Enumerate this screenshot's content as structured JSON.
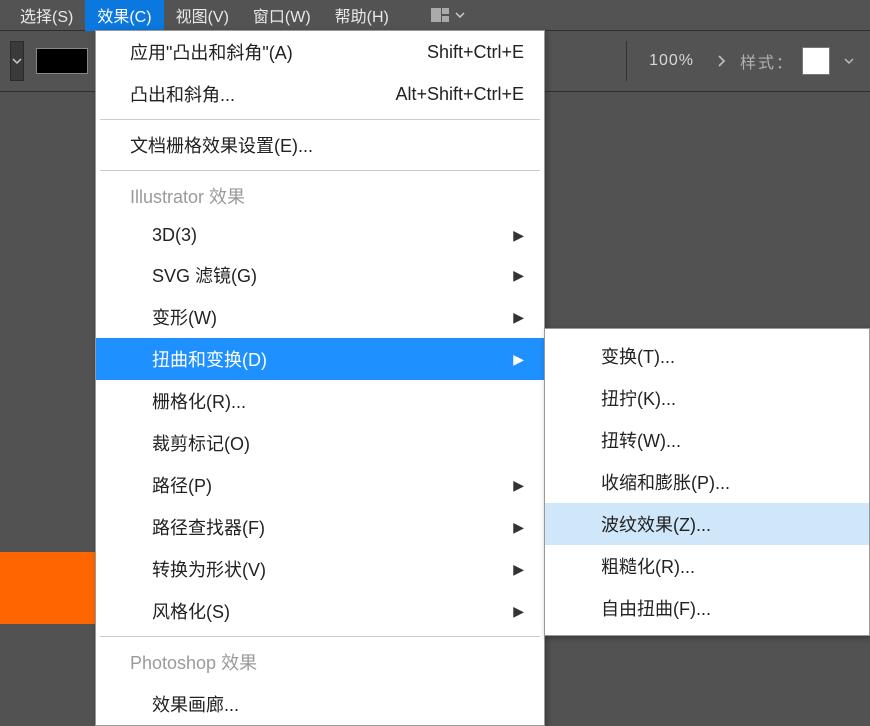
{
  "menubar": {
    "items": [
      {
        "label": "选择(S)"
      },
      {
        "label": "效果(C)"
      },
      {
        "label": "视图(V)"
      },
      {
        "label": "窗口(W)"
      },
      {
        "label": "帮助(H)"
      }
    ]
  },
  "toolbar": {
    "zoom": "100%",
    "style_label": "样式："
  },
  "effects_menu": {
    "apply_last": {
      "label": "应用\"凸出和斜角\"(A)",
      "shortcut": "Shift+Ctrl+E"
    },
    "extrude": {
      "label": "凸出和斜角...",
      "shortcut": "Alt+Shift+Ctrl+E"
    },
    "doc_raster": "文档栅格效果设置(E)...",
    "section_il": "Illustrator 效果",
    "il_items": [
      {
        "label": "3D(3)",
        "arrow": true
      },
      {
        "label": "SVG 滤镜(G)",
        "arrow": true
      },
      {
        "label": "变形(W)",
        "arrow": true
      },
      {
        "label": "扭曲和变换(D)",
        "arrow": true,
        "highlight": true
      },
      {
        "label": "栅格化(R)..."
      },
      {
        "label": "裁剪标记(O)"
      },
      {
        "label": "路径(P)",
        "arrow": true
      },
      {
        "label": "路径查找器(F)",
        "arrow": true
      },
      {
        "label": "转换为形状(V)",
        "arrow": true
      },
      {
        "label": "风格化(S)",
        "arrow": true
      }
    ],
    "section_ps": "Photoshop 效果",
    "ps_item": "效果画廊..."
  },
  "distort_submenu": {
    "items": [
      {
        "label": "变换(T)..."
      },
      {
        "label": "扭拧(K)..."
      },
      {
        "label": "扭转(W)..."
      },
      {
        "label": "收缩和膨胀(P)..."
      },
      {
        "label": "波纹效果(Z)...",
        "hover": true
      },
      {
        "label": "粗糙化(R)..."
      },
      {
        "label": "自由扭曲(F)..."
      }
    ]
  }
}
